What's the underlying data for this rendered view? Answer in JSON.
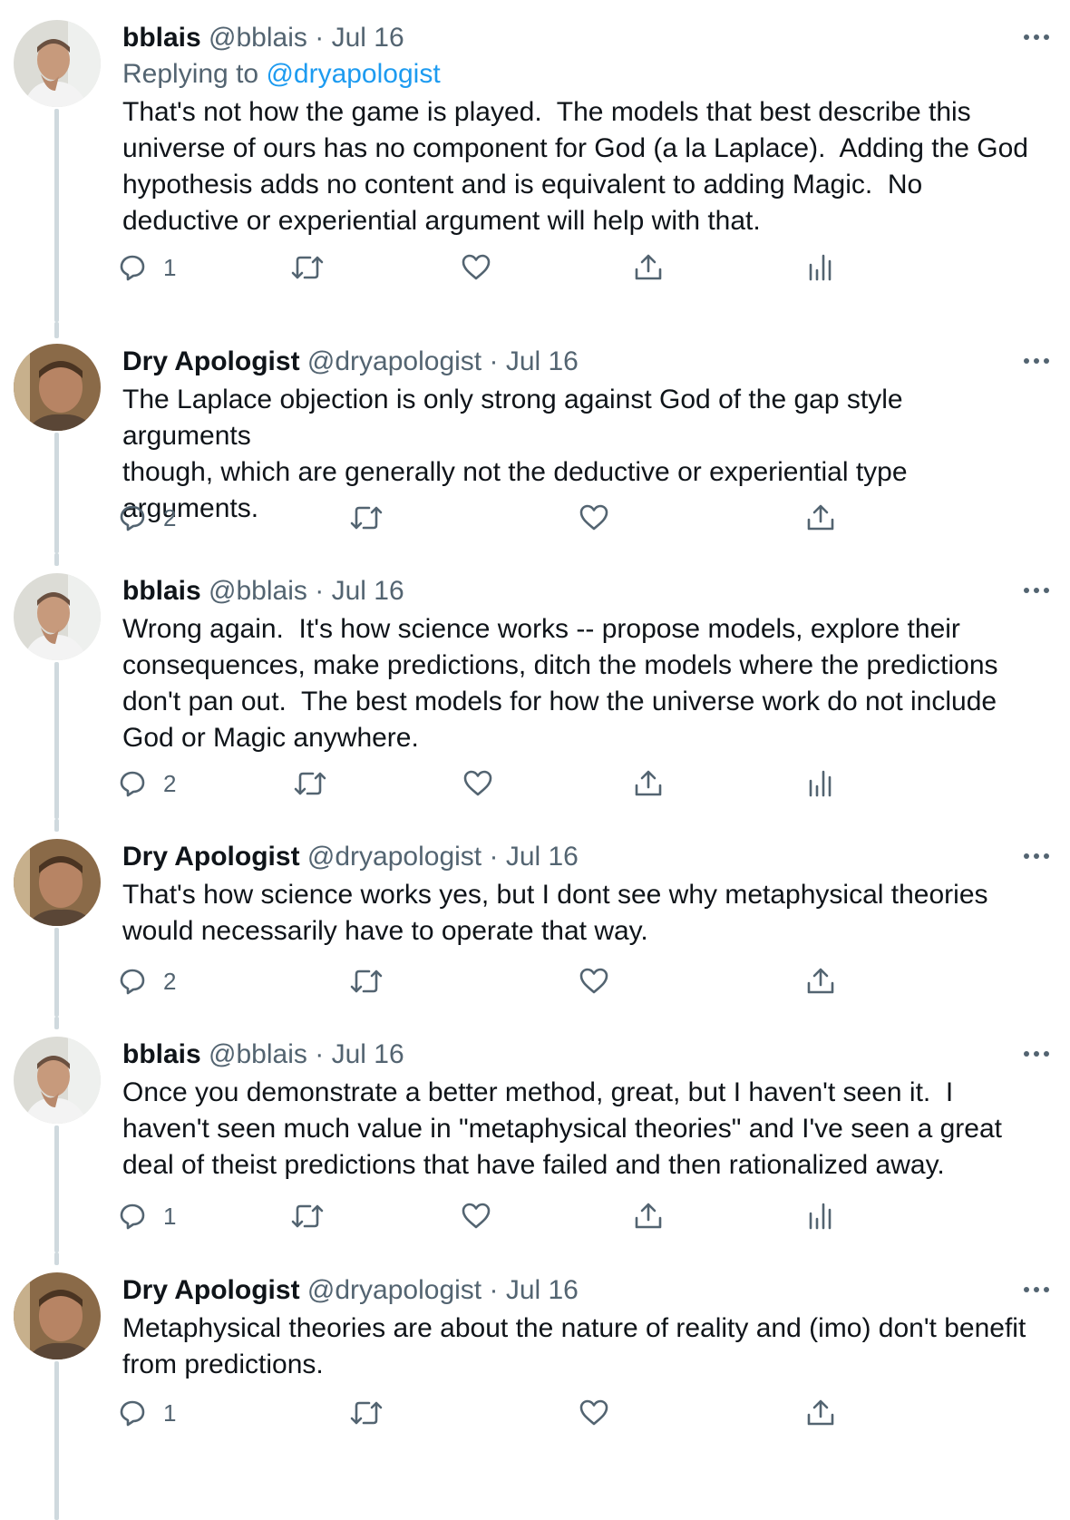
{
  "tweets": [
    {
      "author": "bblais",
      "handle": "@bblais",
      "separator": "·",
      "date": "Jul 16",
      "replying_prefix": "Replying to ",
      "replying_to": "@dryapologist",
      "text": "That's not how the game is played.  The models that best describe this\nuniverse of ours has no component for God (a la Laplace).  Adding the God\nhypothesis adds no content and is equivalent to adding Magic.  No\ndeductive or experiential argument will help with that.",
      "reply_count": "1",
      "has_analytics": true
    },
    {
      "author": "Dry Apologist",
      "handle": "@dryapologist",
      "separator": "·",
      "date": "Jul 16",
      "text": "The Laplace objection is only strong against God of the gap style arguments\nthough, which are generally not the deductive or experiential type\narguments.",
      "reply_count": "2",
      "has_analytics": false
    },
    {
      "author": "bblais",
      "handle": "@bblais",
      "separator": "·",
      "date": "Jul 16",
      "text": "Wrong again.  It's how science works -- propose models, explore their\nconsequences, make predictions, ditch the models where the predictions\ndon't pan out.  The best models for how the universe work do not include\nGod or Magic anywhere.",
      "reply_count": "2",
      "has_analytics": true
    },
    {
      "author": "Dry Apologist",
      "handle": "@dryapologist",
      "separator": "·",
      "date": "Jul 16",
      "text": "That's how science works yes, but I dont see why metaphysical theories\nwould necessarily have to operate that way.",
      "reply_count": "2",
      "has_analytics": false
    },
    {
      "author": "bblais",
      "handle": "@bblais",
      "separator": "·",
      "date": "Jul 16",
      "text": "Once you demonstrate a better method, great, but I haven't seen it.  I\nhaven't seen much value in \"metaphysical theories\" and I've seen a great\ndeal of theist predictions that have failed and then rationalized away.",
      "reply_count": "1",
      "has_analytics": true
    },
    {
      "author": "Dry Apologist",
      "handle": "@dryapologist",
      "separator": "·",
      "date": "Jul 16",
      "text": "Metaphysical theories are about the nature of reality and (imo) don't benefit\nfrom predictions.",
      "reply_count": "1",
      "has_analytics": false
    }
  ],
  "colors": {
    "text": "#0f1419",
    "secondary": "#536471",
    "mention": "#1d9bf0",
    "thread_line": "#cfd9de"
  },
  "icons": [
    "reply-icon",
    "retweet-icon",
    "like-icon",
    "share-icon",
    "analytics-icon",
    "more-icon"
  ]
}
